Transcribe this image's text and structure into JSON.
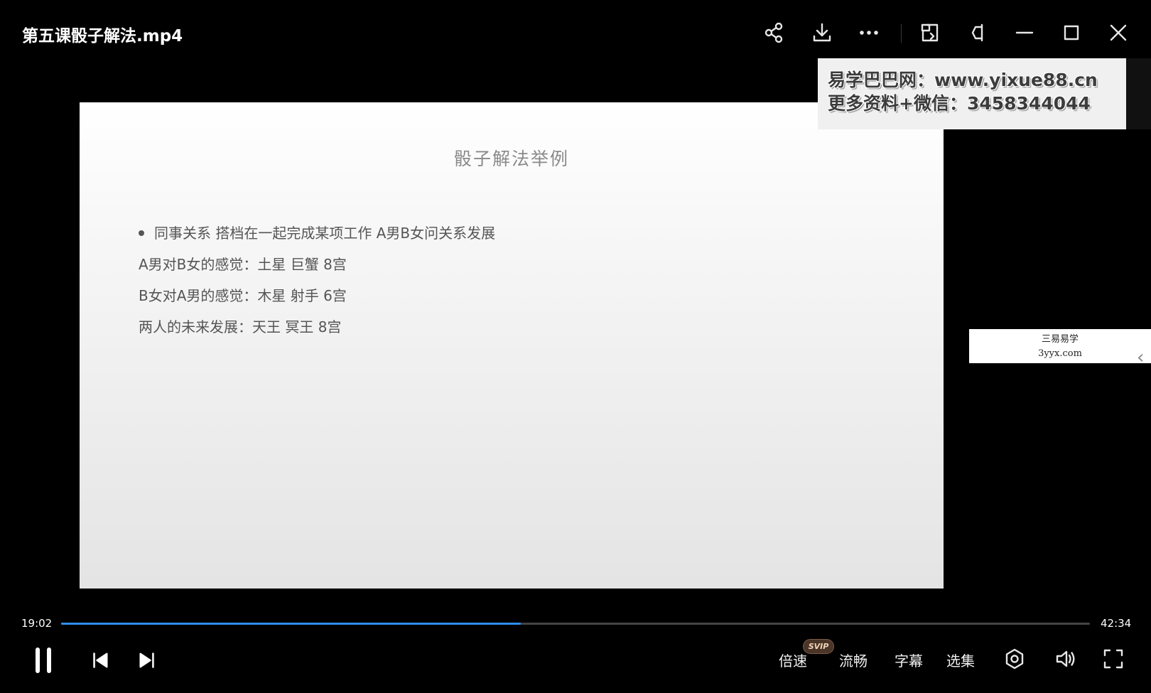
{
  "window": {
    "title": "第五课骰子解法.mp4"
  },
  "titlebar_icons": [
    "share-icon",
    "download-icon",
    "more-icon",
    "mini-player-icon",
    "pin-icon",
    "minimize-icon",
    "maximize-icon",
    "close-icon"
  ],
  "slide": {
    "title": "骰子解法举例",
    "bullet": "同事关系 搭档在一起完成某项工作 A男B女问关系发展",
    "lines": [
      "A男对B女的感觉：土星 巨蟹 8宫",
      "B女对A男的感觉：木星 射手 6宫",
      "两人的未来发展：天王 冥王 8宫"
    ]
  },
  "watermarks": {
    "top_right_line1": "易学巴巴网：www.yixue88.cn",
    "top_right_line2": "更多资料+微信：3458344044",
    "side_line1": "三易易学",
    "side_line2": "3yyx.com"
  },
  "player": {
    "current_time": "19:02",
    "total_time": "42:34",
    "progress_fraction": 0.447,
    "accent_color": "#2f8ff0",
    "speed_label": "倍速",
    "speed_badge": "SVIP",
    "quality_label": "流畅",
    "subtitle_label": "字幕",
    "episodes_label": "选集"
  }
}
